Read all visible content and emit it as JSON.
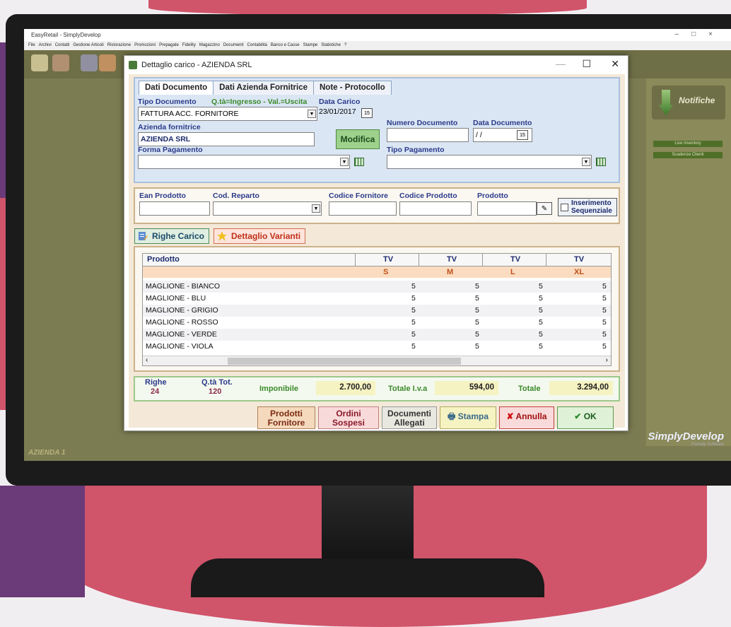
{
  "app": {
    "title": "EasyRetail - SimplyDevelop",
    "menu": [
      "File",
      "Archivi",
      "Contatti",
      "Gestione Articoli",
      "Ristorazione",
      "Promozioni",
      "Prepagate",
      "Fidelity",
      "Magazzino",
      "Documenti",
      "Contabilità",
      "Banco e Casse",
      "Stampe",
      "Statistiche",
      "?"
    ],
    "company_label": "AZIENDA 1",
    "notifiche_label": "Notifiche",
    "panel_buttons": [
      "Live Inventory",
      "Scadenze Clienti"
    ],
    "logo_text": "SimplyDevelop",
    "logo_sub": "Friendly Software"
  },
  "dialog": {
    "title": "Dettaglio carico - AZIENDA SRL",
    "tabs": [
      "Dati Documento",
      "Dati Azienda Fornitrice",
      "Note - Protocollo"
    ],
    "tipo_documento_label": "Tipo Documento",
    "qta_hint": "Q.tà=Ingresso - Val.=Uscita",
    "tipo_documento_value": "FATTURA ACC. FORNITORE",
    "data_carico_label": "Data Carico",
    "data_carico_value": "23/01/2017",
    "azienda_label": "Azienda fornitrice",
    "azienda_value": "AZIENDA SRL",
    "modifica_label": "Modifica",
    "numero_doc_label": "Numero Documento",
    "numero_doc_value": "",
    "data_doc_label": "Data Documento",
    "data_doc_value": "/ /",
    "forma_pag_label": "Forma Pagamento",
    "tipo_pag_label": "Tipo Pagamento",
    "ean_label": "Ean Prodotto",
    "cod_reparto_label": "Cod. Reparto",
    "codice_fornitore_label": "Codice Fornitore",
    "codice_prodotto_label": "Codice Prodotto",
    "prodotto_label": "Prodotto",
    "inserimento_label_1": "Inserimento",
    "inserimento_label_2": "Sequenziale",
    "righe_carico_tab": "Righe Carico",
    "dettaglio_varianti_tab": "Dettaglio Varianti"
  },
  "table": {
    "product_header": "Prodotto",
    "columns": [
      {
        "group": "TV",
        "size": "S"
      },
      {
        "group": "TV",
        "size": "M"
      },
      {
        "group": "TV",
        "size": "L"
      },
      {
        "group": "TV",
        "size": "XL"
      }
    ],
    "rows": [
      {
        "name": "MAGLIONE - BIANCO",
        "values": [
          "5",
          "5",
          "5",
          "5"
        ]
      },
      {
        "name": "MAGLIONE - BLU",
        "values": [
          "5",
          "5",
          "5",
          "5"
        ]
      },
      {
        "name": "MAGLIONE - GRIGIO",
        "values": [
          "5",
          "5",
          "5",
          "5"
        ]
      },
      {
        "name": "MAGLIONE - ROSSO",
        "values": [
          "5",
          "5",
          "5",
          "5"
        ]
      },
      {
        "name": "MAGLIONE - VERDE",
        "values": [
          "5",
          "5",
          "5",
          "5"
        ]
      },
      {
        "name": "MAGLIONE - VIOLA",
        "values": [
          "5",
          "5",
          "5",
          "5"
        ]
      }
    ]
  },
  "totals": {
    "righe_label": "Righe",
    "righe_value": "24",
    "qta_label": "Q.tà Tot.",
    "qta_value": "120",
    "imponibile_label": "Imponibile",
    "imponibile_value": "2.700,00",
    "iva_label": "Totale I.v.a",
    "iva_value": "594,00",
    "totale_label": "Totale",
    "totale_value": "3.294,00"
  },
  "actions": {
    "prodotti_1": "Prodotti",
    "prodotti_2": "Fornitore",
    "ordini_1": "Ordini",
    "ordini_2": "Sospesi",
    "documenti_1": "Documenti",
    "documenti_2": "Allegati",
    "stampa": "Stampa",
    "annulla": "Annulla",
    "ok": "OK"
  },
  "colors": {
    "accent_blue": "#2a3a8a",
    "accent_green": "#3a8a2a",
    "variant_orange": "#c0501a"
  }
}
